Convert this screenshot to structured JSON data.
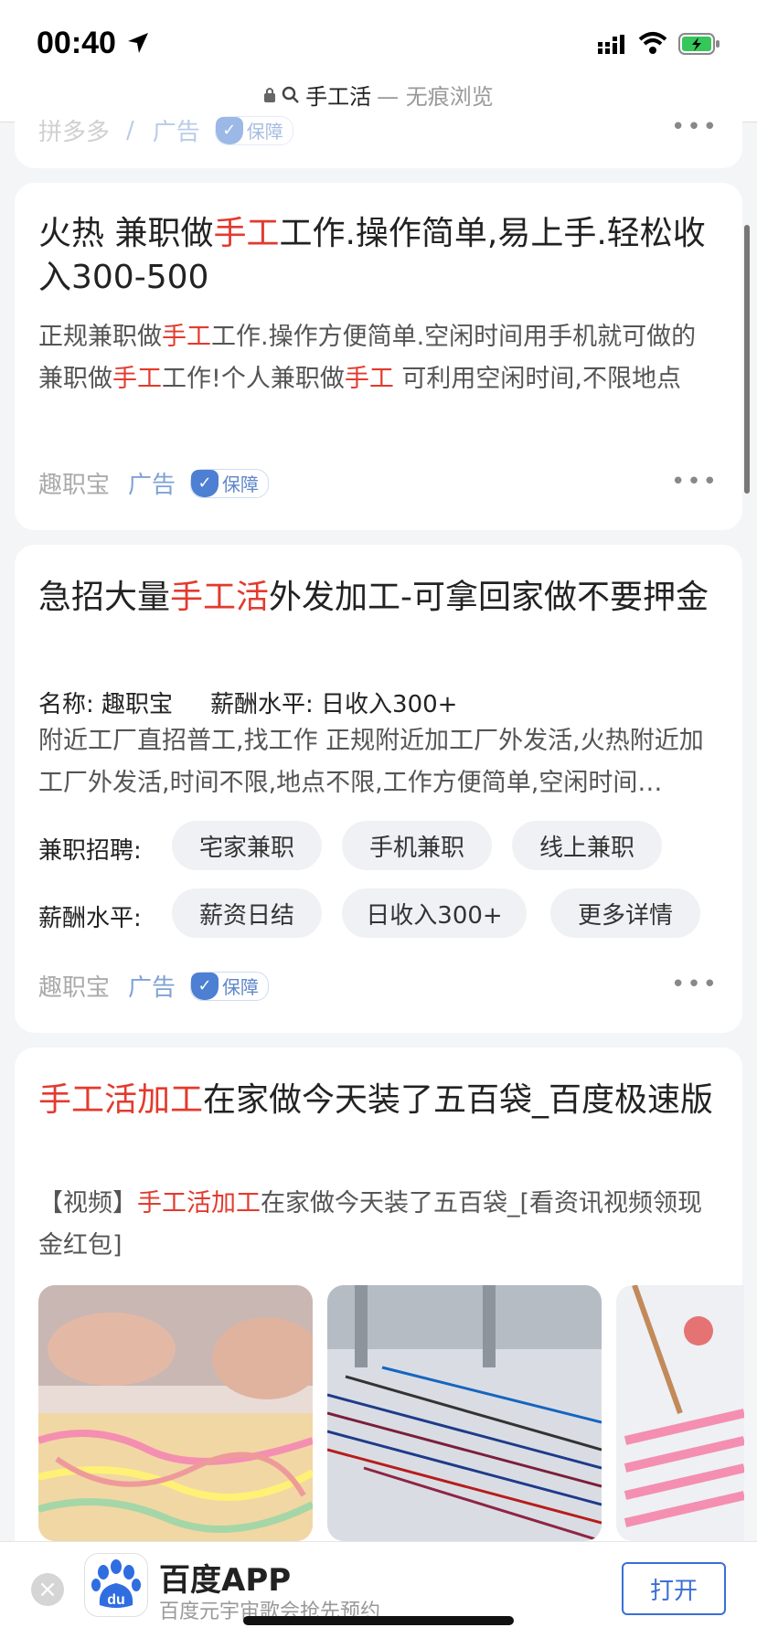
{
  "status_bar": {
    "time": "00:40"
  },
  "address_bar": {
    "query": "手工活",
    "suffix": " — 无痕浏览"
  },
  "card_prev": {
    "source": "拼多多",
    "ad_label": "广告",
    "badge": "保障"
  },
  "card1": {
    "title_pre": "火热 兼职做",
    "title_hl": "手工",
    "title_post": "工作.操作简单,易上手.轻松收入300-500",
    "desc_1": "正规兼职做",
    "desc_hl1": "手工",
    "desc_2": "工作.操作方便简单.空闲时间用手机就可做的兼职做",
    "desc_hl2": "手工",
    "desc_3": "工作!个人兼职做",
    "desc_hl3": "手工",
    "desc_4": " 可利用空闲时间,不限地点",
    "source": "趣职宝",
    "ad_label": "广告",
    "badge": "保障"
  },
  "card2": {
    "title_pre": "急招大量",
    "title_hl": "手工活",
    "title_post": "外发加工-可拿回家做不要押金",
    "name_line": "名称: 趣职宝",
    "salary_line": "薪酬水平: 日收入300+",
    "desc": "附近工厂直招普工,找工作 正规附近加工厂外发活,火热附近加工厂外发活,时间不限,地点不限,工作方便简单,空闲时间…",
    "row1_label": "兼职招聘:",
    "row1_chips": [
      "宅家兼职",
      "手机兼职",
      "线上兼职"
    ],
    "row2_label": "薪酬水平:",
    "row2_chips": [
      "薪资日结",
      "日收入300+",
      "更多详情"
    ],
    "source": "趣职宝",
    "ad_label": "广告",
    "badge": "保障"
  },
  "card3": {
    "title_hl": "手工活加工",
    "title_post": "在家做今天装了五百袋_百度极速版",
    "desc_pre": "【视频】",
    "desc_hl": "手工活加工",
    "desc_post": "在家做今天装了五百袋_[看资讯视频领现金红包]"
  },
  "bottom_banner": {
    "logo_text": "du",
    "app_name": "百度APP",
    "subtitle": "百度元宇宙歌会抢先预约",
    "open_label": "打开"
  },
  "colors": {
    "highlight": "#e33a2e",
    "ad_blue": "#7fa1d6",
    "button_blue": "#3a6fd8"
  }
}
